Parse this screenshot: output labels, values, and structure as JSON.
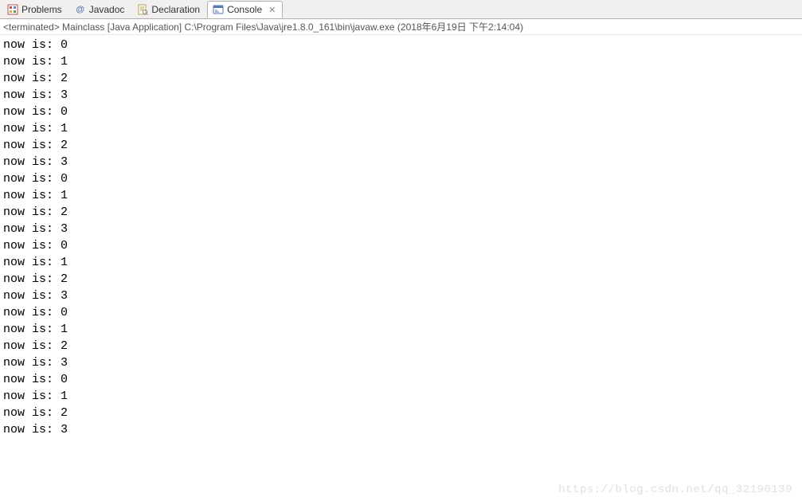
{
  "tabs": [
    {
      "label": "Problems",
      "icon": "problems-icon",
      "active": false
    },
    {
      "label": "Javadoc",
      "icon": "javadoc-icon",
      "active": false
    },
    {
      "label": "Declaration",
      "icon": "declaration-icon",
      "active": false
    },
    {
      "label": "Console",
      "icon": "console-icon",
      "active": true,
      "closable": true
    }
  ],
  "close_glyph": "✕",
  "status_line": "<terminated> Mainclass [Java Application] C:\\Program Files\\Java\\jre1.8.0_161\\bin\\javaw.exe (2018年6月19日 下午2:14:04)",
  "console_lines": [
    "now is: 0",
    "now is: 1",
    "now is: 2",
    "now is: 3",
    "now is: 0",
    "now is: 1",
    "now is: 2",
    "now is: 3",
    "now is: 0",
    "now is: 1",
    "now is: 2",
    "now is: 3",
    "now is: 0",
    "now is: 1",
    "now is: 2",
    "now is: 3",
    "now is: 0",
    "now is: 1",
    "now is: 2",
    "now is: 3",
    "now is: 0",
    "now is: 1",
    "now is: 2",
    "now is: 3"
  ],
  "watermark": "https://blog.csdn.net/qq_32190139"
}
